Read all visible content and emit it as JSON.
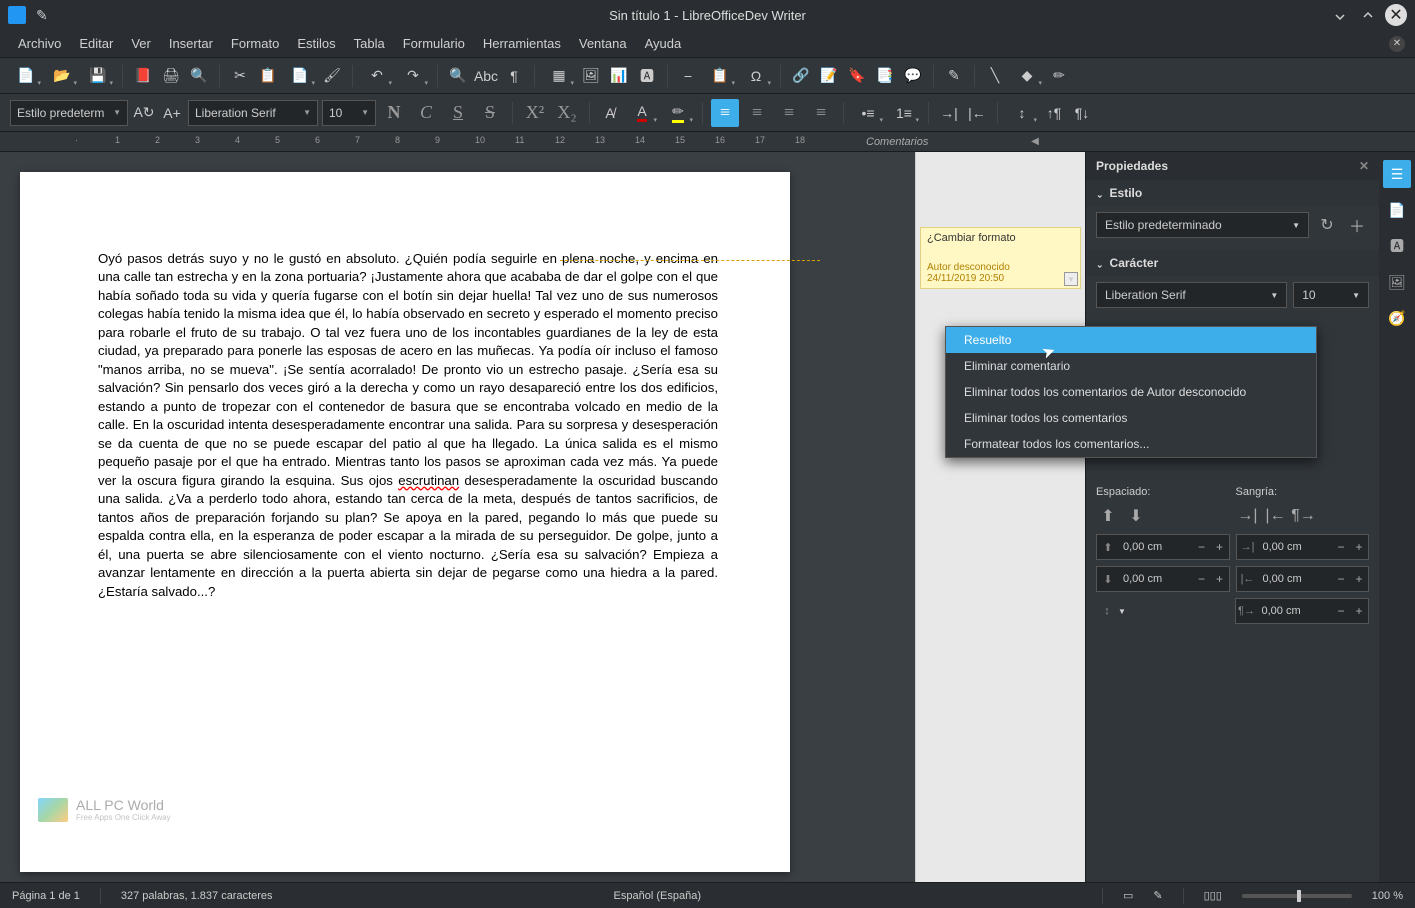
{
  "window": {
    "title": "Sin título 1 - LibreOfficeDev Writer"
  },
  "menus": [
    "Archivo",
    "Editar",
    "Ver",
    "Insertar",
    "Formato",
    "Estilos",
    "Tabla",
    "Formulario",
    "Herramientas",
    "Ventana",
    "Ayuda"
  ],
  "toolbar2": {
    "para_style": "Estilo predeterm",
    "font_name": "Liberation Serif",
    "font_size": "10"
  },
  "ruler": {
    "marks": [
      1,
      2,
      3,
      4,
      5,
      6,
      7,
      8,
      9,
      10,
      11,
      12,
      13,
      14,
      15,
      16,
      17,
      18
    ],
    "comments_label": "Comentarios"
  },
  "document": {
    "body": "Oyó pasos detrás suyo y no le gustó en absoluto. ¿Quién podía seguirle en plena noche, y encima en una calle tan estrecha y en la zona portuaria? ¡Justamente ahora que acababa de dar el golpe con el que había soñado toda su vida y quería fugarse con el botín sin dejar huella! Tal vez uno de sus numerosos colegas había tenido la misma idea que él, lo había observado en secreto y esperado el momento preciso para robarle el fruto de su trabajo. O tal vez fuera uno de los incontables guardianes de la ley de esta ciudad, ya preparado para ponerle las esposas de acero en las muñecas. Ya podía oír incluso el famoso  \"manos arriba, no se mueva\". ¡Se sentía acorralado! De pronto vio un estrecho pasaje. ¿Sería esa su salvación? Sin pensarlo dos veces giró a la derecha y como un rayo desapareció entre los dos edificios, estando a punto de tropezar con el contenedor de basura que se encontraba volcado en medio de la calle. En la oscuridad intenta desesperadamente encontrar una salida. Para su sorpresa y desesperación se da cuenta de que no se puede escapar del patio al que ha llegado. La única salida es el mismo pequeño pasaje por el que ha entrado. Mientras tanto los pasos se aproximan cada vez más. Ya puede ver la oscura figura girando la esquina. Sus ojos ",
    "spell_word": "escrutinan",
    "body2": " desesperadamente la oscuridad buscando una salida. ¿Va a perderlo todo ahora, estando tan cerca de la meta, después de tantos sacrificios, de tantos años de preparación forjando su plan? Se apoya en la pared, pegando lo más que puede su espalda contra ella, en la esperanza de poder escapar a la mirada de su perseguidor. De golpe, junto a él, una puerta se abre silenciosamente con el viento nocturno. ¿Sería esa su salvación? Empieza a avanzar lentamente en dirección a la puerta abierta sin dejar de pegarse como una hiedra a la pared. ¿Estaría salvado...?"
  },
  "comment": {
    "text": "¿Cambiar formato",
    "author": "Autor desconocido",
    "date": "24/11/2019 20:50"
  },
  "context_menu": [
    "Resuelto",
    "Eliminar comentario",
    "Eliminar todos los comentarios de Autor desconocido",
    "Eliminar todos los comentarios",
    "Formatear todos los comentarios..."
  ],
  "sidebar": {
    "title": "Propiedades",
    "style_section": "Estilo",
    "style_value": "Estilo predeterminado",
    "char_section": "Carácter",
    "char_font": "Liberation Serif",
    "char_size": "10",
    "spacing_label": "Espaciado:",
    "indent_label": "Sangría:",
    "zero": "0,00 cm"
  },
  "statusbar": {
    "page": "Página 1 de 1",
    "words": "327 palabras, 1.837 caracteres",
    "lang": "Español (España)",
    "zoom": "100 %"
  },
  "watermark": {
    "line1": "ALL PC World",
    "line2": "Free Apps One Click Away"
  }
}
